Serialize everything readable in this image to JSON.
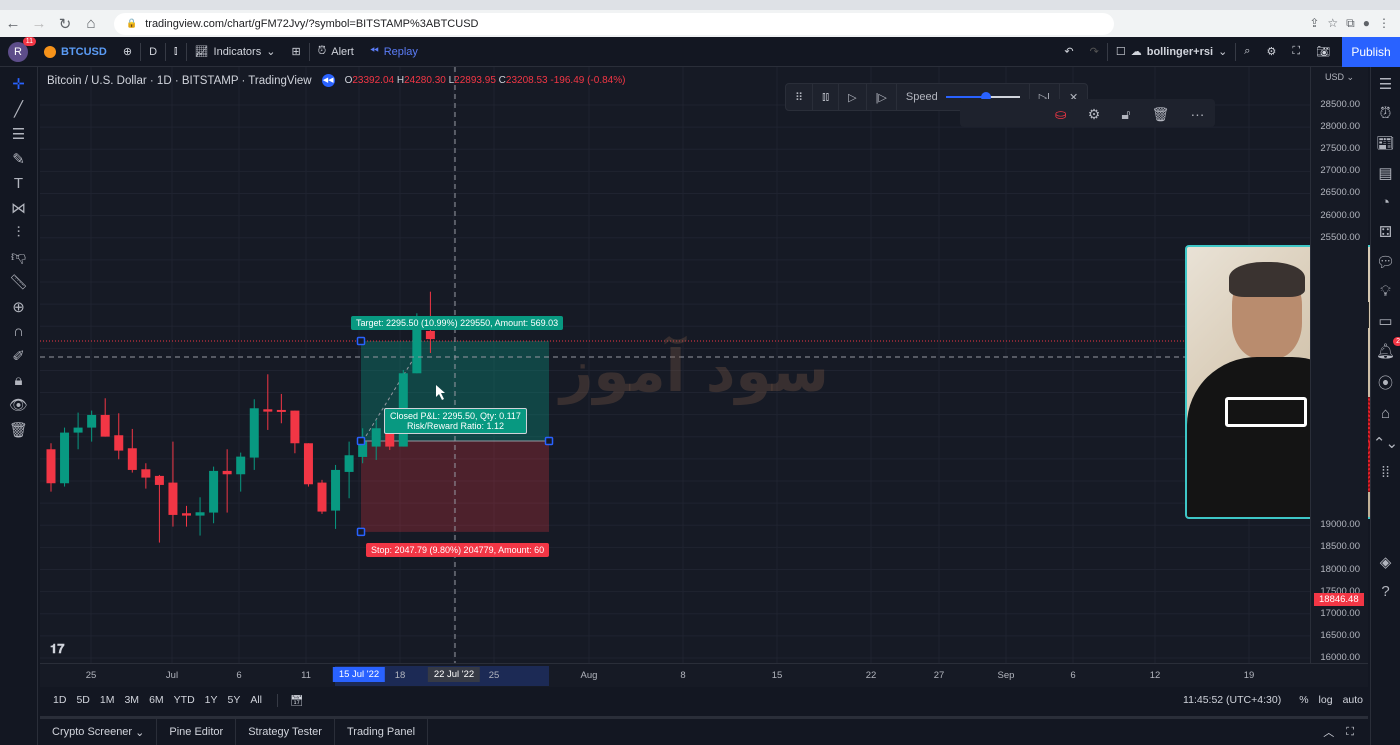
{
  "browser": {
    "url": "tradingview.com/chart/gFM72Jvy/?symbol=BITSTAMP%3ABTCUSD"
  },
  "toolbar": {
    "avatar_letter": "R",
    "notifications": "11",
    "symbol": "BTCUSD",
    "interval": "D",
    "indicators": "Indicators",
    "alert": "Alert",
    "replay": "Replay",
    "layout_name": "bollinger+rsi",
    "publish": "Publish"
  },
  "legend": {
    "title": "Bitcoin / U.S. Dollar · 1D · BITSTAMP · TradingView",
    "o_label": "O",
    "o": "23392.04",
    "h_label": "H",
    "h": "24280.30",
    "l_label": "L",
    "l": "22893.95",
    "c_label": "C",
    "c": "23208.53",
    "change": "-196.49 (-0.84%)"
  },
  "replay_bar": {
    "speed_label": "Speed",
    "speed_level": 0.55
  },
  "position_tool": {
    "target_label": "Target: 2295.50 (10.99%) 229550, Amount: 569.03",
    "pnl_line1": "Closed P&L: 2295.50, Qty: 0.117",
    "pnl_line2": "Risk/Reward Ratio: 1.12",
    "stop_label": "Stop: 2047.79 (9.80%) 204779, Amount: 60",
    "target_price": 23166,
    "entry_price": 20906,
    "stop_price": 18850,
    "start_date": "2022-07-15",
    "end_date": "2022-07-29"
  },
  "watermark": "سود آموز",
  "price_axis": {
    "currency": "USD",
    "ticks": [
      "28500.00",
      "28000.00",
      "27500.00",
      "27000.00",
      "26500.00",
      "26000.00",
      "25500.00",
      "19000.00",
      "18500.00",
      "18000.00",
      "17500.00",
      "17000.00",
      "16500.00",
      "16000.00"
    ],
    "current_price_label": "18846.48"
  },
  "time_axis": {
    "ticks": [
      "25",
      "Jul",
      "6",
      "11",
      "15 Jul '22",
      "18",
      "22 Jul '22",
      "25",
      "Aug",
      "8",
      "15",
      "22",
      "27",
      "Sep",
      "6",
      "12",
      "19"
    ]
  },
  "range_bar": {
    "ranges": [
      "1D",
      "5D",
      "1M",
      "3M",
      "6M",
      "YTD",
      "1Y",
      "5Y",
      "All"
    ],
    "clock": "11:45:52 (UTC+4:30)",
    "percent": "%",
    "log": "log",
    "auto": "auto"
  },
  "bottom_tabs": [
    "Crypto Screener",
    "Pine Editor",
    "Strategy Tester",
    "Trading Panel"
  ],
  "right_sidebar": {
    "badge": "2"
  },
  "colors": {
    "up": "#089981",
    "down": "#f23645",
    "accent": "#2962ff",
    "bg": "#161a25"
  },
  "chart_data": {
    "type": "candlestick",
    "symbol": "BTCUSD",
    "exchange": "BITSTAMP",
    "interval": "1D",
    "ylim": [
      16000,
      28700
    ],
    "dates": [
      "2022-06-22",
      "2022-06-23",
      "2022-06-24",
      "2022-06-25",
      "2022-06-26",
      "2022-06-27",
      "2022-06-28",
      "2022-06-29",
      "2022-06-30",
      "2022-07-01",
      "2022-07-02",
      "2022-07-03",
      "2022-07-04",
      "2022-07-05",
      "2022-07-06",
      "2022-07-07",
      "2022-07-08",
      "2022-07-09",
      "2022-07-10",
      "2022-07-11",
      "2022-07-12",
      "2022-07-13",
      "2022-07-14",
      "2022-07-15",
      "2022-07-16",
      "2022-07-17",
      "2022-07-18",
      "2022-07-19",
      "2022-07-20"
    ],
    "ohlc": [
      [
        20718,
        20854,
        19761,
        19950
      ],
      [
        19950,
        21208,
        19875,
        21095
      ],
      [
        21095,
        21547,
        20718,
        21208
      ],
      [
        21208,
        21592,
        20891,
        21494
      ],
      [
        21494,
        21871,
        21004,
        21004
      ],
      [
        21035,
        21532,
        20492,
        20688
      ],
      [
        20741,
        21178,
        20191,
        20251
      ],
      [
        20266,
        20402,
        19829,
        20078
      ],
      [
        20116,
        20138,
        18609,
        19912
      ],
      [
        19965,
        20891,
        18971,
        19234
      ],
      [
        19272,
        19438,
        18971,
        19219
      ],
      [
        19219,
        19633,
        18767,
        19294
      ],
      [
        19287,
        20326,
        19046,
        20229
      ],
      [
        20229,
        20718,
        19287,
        20153
      ],
      [
        20153,
        20643,
        19761,
        20552
      ],
      [
        20530,
        21848,
        20251,
        21645
      ],
      [
        21622,
        22413,
        21155,
        21569
      ],
      [
        21607,
        21969,
        21306,
        21569
      ],
      [
        21592,
        21592,
        20628,
        20854
      ],
      [
        20854,
        20854,
        19875,
        19927
      ],
      [
        19965,
        20025,
        19257,
        19310
      ],
      [
        19332,
        20364,
        18918,
        20251
      ],
      [
        20206,
        20891,
        19611,
        20583
      ],
      [
        20545,
        21193,
        20402,
        20891
      ],
      [
        20779,
        21381,
        20477,
        21193
      ],
      [
        21140,
        21140,
        20703,
        20779
      ],
      [
        20779,
        22511,
        20779,
        22436
      ],
      [
        22436,
        23792,
        22436,
        23415
      ],
      [
        23392.04,
        24280.3,
        22893.95,
        23208.53
      ]
    ]
  }
}
